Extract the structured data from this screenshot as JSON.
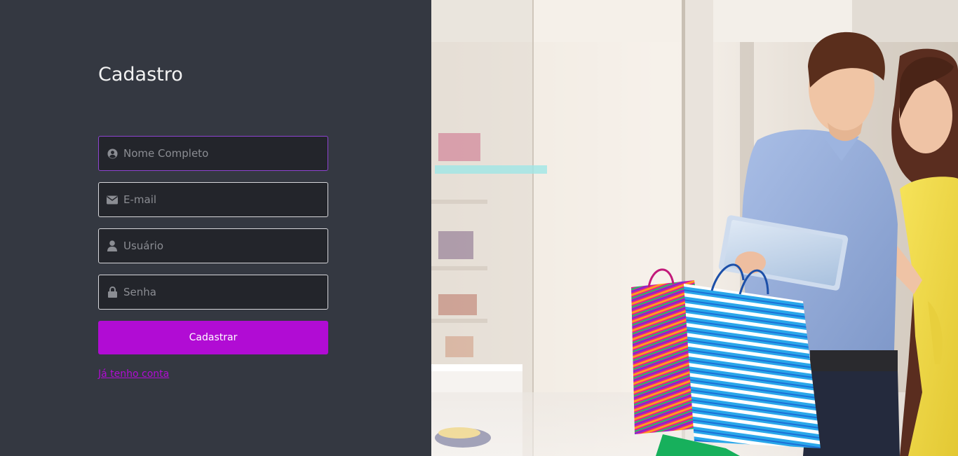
{
  "form": {
    "title": "Cadastro",
    "fields": [
      {
        "placeholder": "Nome Completo",
        "icon": "user-circle-icon"
      },
      {
        "placeholder": "E-mail",
        "icon": "envelope-icon"
      },
      {
        "placeholder": "Usuário",
        "icon": "user-icon"
      },
      {
        "placeholder": "Senha",
        "icon": "lock-icon"
      }
    ],
    "submit_label": "Cadastrar",
    "login_link": "Já tenho conta"
  },
  "colors": {
    "background": "#343841",
    "input_background": "#23252b",
    "accent": "#b10cd4",
    "focus_border": "#8e44d1"
  },
  "hero_image": {
    "subject": "couple-shopping-photo"
  }
}
